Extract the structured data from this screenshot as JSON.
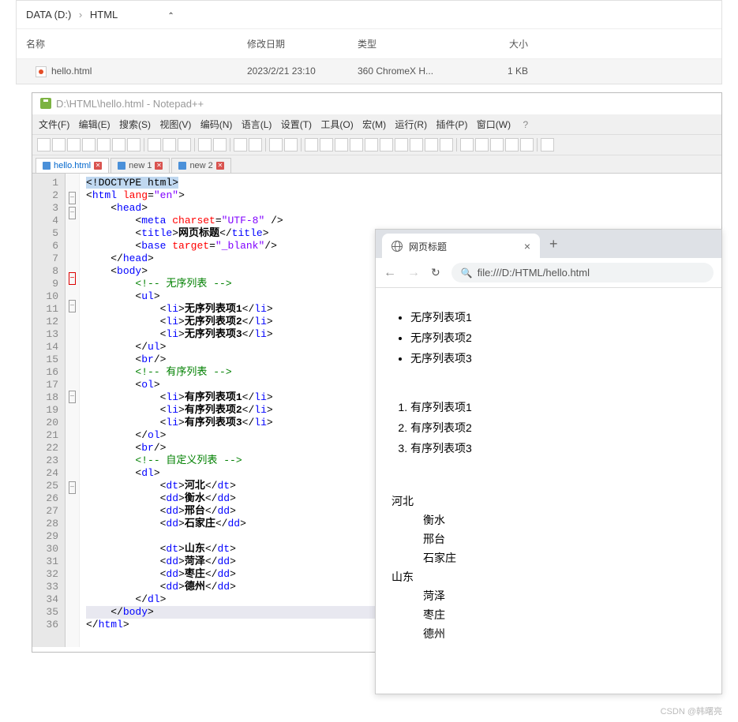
{
  "explorer": {
    "path_root": "DATA (D:)",
    "path_child": "HTML",
    "headers": {
      "name": "名称",
      "date": "修改日期",
      "type": "类型",
      "size": "大小"
    },
    "file": {
      "name": "hello.html",
      "date": "2023/2/21 23:10",
      "type": "360 ChromeX H...",
      "size": "1 KB"
    }
  },
  "npp": {
    "title": "D:\\HTML\\hello.html - Notepad++",
    "menu": [
      "文件(F)",
      "编辑(E)",
      "搜索(S)",
      "视图(V)",
      "编码(N)",
      "语言(L)",
      "设置(T)",
      "工具(O)",
      "宏(M)",
      "运行(R)",
      "插件(P)",
      "窗口(W)"
    ],
    "help": "?",
    "tabs": [
      {
        "label": "hello.html",
        "active": true
      },
      {
        "label": "new 1",
        "active": false
      },
      {
        "label": "new 2",
        "active": false
      }
    ],
    "code": [
      {
        "n": 1,
        "html": "<span class='hl-sel'>&lt;!DOCTYPE html&gt;</span>"
      },
      {
        "n": 2,
        "html": "&lt;<span class='hl-blue'>html</span> <span class='hl-red'>lang</span>=<span class='hl-purple'>\"en\"</span>&gt;"
      },
      {
        "n": 3,
        "html": "    &lt;<span class='hl-blue'>head</span>&gt;"
      },
      {
        "n": 4,
        "html": "        &lt;<span class='hl-blue'>meta</span> <span class='hl-red'>charset</span>=<span class='hl-purple'>\"UTF-8\"</span> /&gt;"
      },
      {
        "n": 5,
        "html": "        &lt;<span class='hl-blue'>title</span>&gt;<span class='hl-black'>网页标题</span>&lt;/<span class='hl-blue'>title</span>&gt;"
      },
      {
        "n": 6,
        "html": "        &lt;<span class='hl-blue'>base</span> <span class='hl-red'>target</span>=<span class='hl-purple'>\"_blank\"</span>/&gt;"
      },
      {
        "n": 7,
        "html": "    &lt;/<span class='hl-blue'>head</span>&gt;"
      },
      {
        "n": 8,
        "html": "    &lt;<span class='hl-blue'>body</span>&gt;"
      },
      {
        "n": 9,
        "html": "        <span class='hl-green'>&lt;!-- 无序列表 --&gt;</span>"
      },
      {
        "n": 10,
        "html": "        &lt;<span class='hl-blue'>ul</span>&gt;"
      },
      {
        "n": 11,
        "html": "            &lt;<span class='hl-blue'>li</span>&gt;<span class='hl-black'>无序列表项1</span>&lt;/<span class='hl-blue'>li</span>&gt;"
      },
      {
        "n": 12,
        "html": "            &lt;<span class='hl-blue'>li</span>&gt;<span class='hl-black'>无序列表项2</span>&lt;/<span class='hl-blue'>li</span>&gt;"
      },
      {
        "n": 13,
        "html": "            &lt;<span class='hl-blue'>li</span>&gt;<span class='hl-black'>无序列表项3</span>&lt;/<span class='hl-blue'>li</span>&gt;"
      },
      {
        "n": 14,
        "html": "        &lt;/<span class='hl-blue'>ul</span>&gt;"
      },
      {
        "n": 15,
        "html": "        &lt;<span class='hl-blue'>br</span>/&gt;"
      },
      {
        "n": 16,
        "html": "        <span class='hl-green'>&lt;!-- 有序列表 --&gt;</span>"
      },
      {
        "n": 17,
        "html": "        &lt;<span class='hl-blue'>ol</span>&gt;"
      },
      {
        "n": 18,
        "html": "            &lt;<span class='hl-blue'>li</span>&gt;<span class='hl-black'>有序列表项1</span>&lt;/<span class='hl-blue'>li</span>&gt;"
      },
      {
        "n": 19,
        "html": "            &lt;<span class='hl-blue'>li</span>&gt;<span class='hl-black'>有序列表项2</span>&lt;/<span class='hl-blue'>li</span>&gt;"
      },
      {
        "n": 20,
        "html": "            &lt;<span class='hl-blue'>li</span>&gt;<span class='hl-black'>有序列表项3</span>&lt;/<span class='hl-blue'>li</span>&gt;"
      },
      {
        "n": 21,
        "html": "        &lt;/<span class='hl-blue'>ol</span>&gt;"
      },
      {
        "n": 22,
        "html": "        &lt;<span class='hl-blue'>br</span>/&gt;"
      },
      {
        "n": 23,
        "html": "        <span class='hl-green'>&lt;!-- 自定义列表 --&gt;</span>"
      },
      {
        "n": 24,
        "html": "        &lt;<span class='hl-blue'>dl</span>&gt;"
      },
      {
        "n": 25,
        "html": "            &lt;<span class='hl-blue'>dt</span>&gt;<span class='hl-black'>河北</span>&lt;/<span class='hl-blue'>dt</span>&gt;"
      },
      {
        "n": 26,
        "html": "            &lt;<span class='hl-blue'>dd</span>&gt;<span class='hl-black'>衡水</span>&lt;/<span class='hl-blue'>dd</span>&gt;"
      },
      {
        "n": 27,
        "html": "            &lt;<span class='hl-blue'>dd</span>&gt;<span class='hl-black'>邢台</span>&lt;/<span class='hl-blue'>dd</span>&gt;"
      },
      {
        "n": 28,
        "html": "            &lt;<span class='hl-blue'>dd</span>&gt;<span class='hl-black'>石家庄</span>&lt;/<span class='hl-blue'>dd</span>&gt;"
      },
      {
        "n": 29,
        "html": ""
      },
      {
        "n": 30,
        "html": "            &lt;<span class='hl-blue'>dt</span>&gt;<span class='hl-black'>山东</span>&lt;/<span class='hl-blue'>dt</span>&gt;"
      },
      {
        "n": 31,
        "html": "            &lt;<span class='hl-blue'>dd</span>&gt;<span class='hl-black'>菏泽</span>&lt;/<span class='hl-blue'>dd</span>&gt;"
      },
      {
        "n": 32,
        "html": "            &lt;<span class='hl-blue'>dd</span>&gt;<span class='hl-black'>枣庄</span>&lt;/<span class='hl-blue'>dd</span>&gt;"
      },
      {
        "n": 33,
        "html": "            &lt;<span class='hl-blue'>dd</span>&gt;<span class='hl-black'>德州</span>&lt;/<span class='hl-blue'>dd</span>&gt;"
      },
      {
        "n": 34,
        "html": "        &lt;/<span class='hl-blue'>dl</span>&gt;"
      },
      {
        "n": 35,
        "html": "    &lt;/<span class='hl-blue'>body</span>&gt;",
        "current": true
      },
      {
        "n": 36,
        "html": "&lt;/<span class='hl-blue'>html</span>&gt;"
      }
    ],
    "fold": [
      "",
      "⊟",
      "⊟",
      "",
      "",
      "",
      "",
      "⊟",
      "",
      "⊟",
      "",
      "",
      "",
      "",
      "",
      "",
      "⊟",
      "",
      "",
      "",
      "",
      "",
      "",
      "⊟",
      "",
      "",
      "",
      "",
      "",
      "",
      "",
      "",
      "",
      "",
      "",
      ""
    ]
  },
  "browser": {
    "tab_title": "网页标题",
    "url": "file:///D:/HTML/hello.html",
    "ul": [
      "无序列表项1",
      "无序列表项2",
      "无序列表项3"
    ],
    "ol": [
      "有序列表项1",
      "有序列表项2",
      "有序列表项3"
    ],
    "dl": [
      {
        "dt": "河北",
        "dd": [
          "衡水",
          "邢台",
          "石家庄"
        ]
      },
      {
        "dt": "山东",
        "dd": [
          "菏泽",
          "枣庄",
          "德州"
        ]
      }
    ]
  },
  "watermark": "CSDN @韩曙亮"
}
